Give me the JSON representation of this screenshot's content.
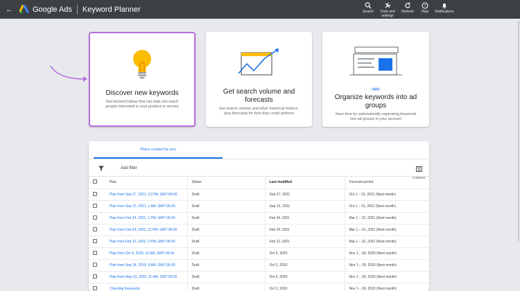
{
  "header": {
    "back_icon": "arrow-back-icon",
    "brand": "Google Ads",
    "page_title": "Keyword Planner",
    "actions": [
      {
        "icon": "search-icon",
        "label": "Search"
      },
      {
        "icon": "wrench-icon",
        "label": "Tools and settings"
      },
      {
        "icon": "refresh-icon",
        "label": "Refresh"
      },
      {
        "icon": "help-icon",
        "label": "Help"
      },
      {
        "icon": "bell-icon",
        "label": "Notifications"
      }
    ]
  },
  "cards": [
    {
      "title": "Discover new keywords",
      "desc": "Get keyword ideas that can help you reach people interested in your product or service"
    },
    {
      "title": "Get search volume and forecasts",
      "desc": "Get search volume and other historical metrics, plus forecasts for how they could perform"
    },
    {
      "badge": "NEW",
      "title": "Organize keywords into ad groups",
      "desc": "Save time by automatically organizing keywords into ad groups in your account"
    }
  ],
  "plans_tab": "Plans created by you",
  "filter": {
    "add_label": "Add filter",
    "columns_label": "Columns"
  },
  "table": {
    "headers": {
      "plan": "Plan",
      "status": "Status",
      "last_modified": "Last modified",
      "forecast": "Forecast period"
    },
    "rows": [
      {
        "plan": "Plan from Sep 27, 2021, 12 PM, GMT-05:00",
        "status": "Draft",
        "modified": "Sep 27, 2021",
        "forecast": "Oct 1 – 31, 2021 (Next month)"
      },
      {
        "plan": "Plan from Sep 15, 2021, 1 AM, GMT-05:00",
        "status": "Draft",
        "modified": "Sep 15, 2021",
        "forecast": "Oct 1 – 31, 2021 (Next month)"
      },
      {
        "plan": "Plan from Feb 24, 2021, 1 PM, GMT-06:00",
        "status": "Draft",
        "modified": "Feb 24, 2021",
        "forecast": "Mar 1 – 31, 2021 (Next month)"
      },
      {
        "plan": "Plan from Feb 24, 2021, 12 PM, GMT-06:00",
        "status": "Draft",
        "modified": "Feb 24, 2021",
        "forecast": "Mar 1 – 31, 2021 (Next month)"
      },
      {
        "plan": "Plan from Feb 12, 2021, 2 PM, GMT-06:00",
        "status": "Draft",
        "modified": "Feb 12, 2021",
        "forecast": "Mar 1 – 31, 2021 (Next month)"
      },
      {
        "plan": "Plan from Oct 9, 2020, 10 AM, GMT-05:00",
        "status": "Draft",
        "modified": "Oct 9, 2020",
        "forecast": "Nov 1 – 30, 2020 (Next month)"
      },
      {
        "plan": "Plan from Sep 24, 2019, 9 AM, GMT-05:00",
        "status": "Draft",
        "modified": "Oct 3, 2020",
        "forecast": "Nov 1 – 30, 2020 (Next month)"
      },
      {
        "plan": "Plan from May 23, 2020, 11 AM, GMT-05:00",
        "status": "Draft",
        "modified": "Oct 3, 2020",
        "forecast": "Nov 1 – 30, 2020 (Next month)"
      },
      {
        "plan": "Churning Keywords",
        "status": "Draft",
        "modified": "Oct 3, 2020",
        "forecast": "Nov 1 – 30, 2020 (Next month)"
      }
    ]
  },
  "colors": {
    "topbar": "#3c4043",
    "link": "#1a73e8",
    "highlight": "#b56ee0",
    "bulb": "#fbbc04"
  }
}
